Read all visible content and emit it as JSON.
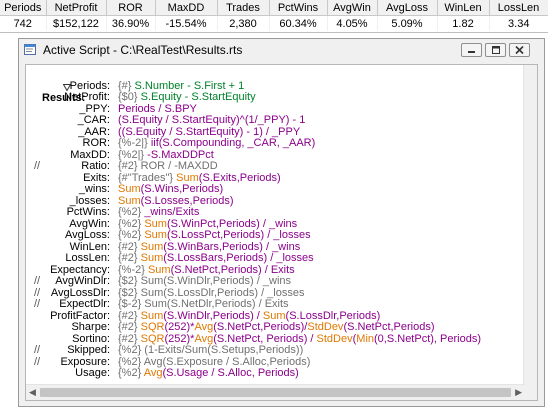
{
  "stats": {
    "headers": [
      "Periods",
      "NetProfit",
      "ROR",
      "MaxDD",
      "Trades",
      "PctWins",
      "AvgWin",
      "AvgLoss",
      "WinLen",
      "LossLen"
    ],
    "values": [
      "742",
      "$152,122",
      "36.90%",
      "-15.54%",
      "2,380",
      "60.34%",
      "4.05%",
      "5.09%",
      "1.82",
      "3.34"
    ]
  },
  "window": {
    "title": "Active Script - C:\\RealTest\\Results.rts",
    "section": "Results:"
  },
  "script": [
    {
      "label": "Periods:",
      "comment": "",
      "segs": [
        [
          "{#} ",
          "gray"
        ],
        [
          "S.Number - S.First + 1",
          "green"
        ]
      ]
    },
    {
      "label": "NetProfit:",
      "comment": "",
      "segs": [
        [
          "{$0} ",
          "gray"
        ],
        [
          "S.Equity - S.StartEquity",
          "green"
        ]
      ]
    },
    {
      "label": "_PPY:",
      "comment": "",
      "segs": [
        [
          "Periods / S.BPY",
          "purple"
        ]
      ]
    },
    {
      "label": "_CAR:",
      "comment": "",
      "segs": [
        [
          "(S.Equity / S.StartEquity)^(1/_PPY) - 1",
          "purple"
        ]
      ]
    },
    {
      "label": "_AAR:",
      "comment": "",
      "segs": [
        [
          "((S.Equity / S.StartEquity) - 1) / _PPY",
          "purple"
        ]
      ]
    },
    {
      "label": "ROR:",
      "comment": "",
      "segs": [
        [
          "{%-2|} ",
          "gray"
        ],
        [
          "iif(S.Compounding, _CAR, _AAR)",
          "purple"
        ]
      ]
    },
    {
      "label": "MaxDD:",
      "comment": "",
      "segs": [
        [
          "{%2|} ",
          "gray"
        ],
        [
          "-S.MaxDDPct",
          "purple"
        ]
      ]
    },
    {
      "label": "Ratio:",
      "comment": "//",
      "segs": [
        [
          "{#2} ROR / -MAXDD",
          "gray"
        ]
      ]
    },
    {
      "label": "Exits:",
      "comment": "",
      "segs": [
        [
          "{#\"Trades\"} ",
          "gray"
        ],
        [
          "Sum",
          "orange"
        ],
        [
          "(S.Exits,Periods)",
          "purple"
        ]
      ]
    },
    {
      "label": "_wins:",
      "comment": "",
      "segs": [
        [
          "Sum",
          "orange"
        ],
        [
          "(S.Wins,Periods)",
          "purple"
        ]
      ]
    },
    {
      "label": "_losses:",
      "comment": "",
      "segs": [
        [
          "Sum",
          "orange"
        ],
        [
          "(S.Losses,Periods)",
          "purple"
        ]
      ]
    },
    {
      "label": "PctWins:",
      "comment": "",
      "segs": [
        [
          "{%2} ",
          "gray"
        ],
        [
          "_wins/Exits",
          "purple"
        ]
      ]
    },
    {
      "label": "AvgWin:",
      "comment": "",
      "segs": [
        [
          "{%2} ",
          "gray"
        ],
        [
          "Sum",
          "orange"
        ],
        [
          "(S.WinPct,Periods) / _wins",
          "purple"
        ]
      ]
    },
    {
      "label": "AvgLoss:",
      "comment": "",
      "segs": [
        [
          "{%2} ",
          "gray"
        ],
        [
          "Sum",
          "orange"
        ],
        [
          "(S.LossPct,Periods) / _losses",
          "purple"
        ]
      ]
    },
    {
      "label": "WinLen:",
      "comment": "",
      "segs": [
        [
          "{#2} ",
          "gray"
        ],
        [
          "Sum",
          "orange"
        ],
        [
          "(S.WinBars,Periods) / _wins",
          "purple"
        ]
      ]
    },
    {
      "label": "LossLen:",
      "comment": "",
      "segs": [
        [
          "{#2} ",
          "gray"
        ],
        [
          "Sum",
          "orange"
        ],
        [
          "(S.LossBars,Periods) / _losses",
          "purple"
        ]
      ]
    },
    {
      "label": "Expectancy:",
      "comment": "",
      "segs": [
        [
          "{%-2} ",
          "gray"
        ],
        [
          "Sum",
          "orange"
        ],
        [
          "(S.NetPct,Periods) / Exits",
          "purple"
        ]
      ]
    },
    {
      "label": "AvgWinDlr:",
      "comment": "//",
      "segs": [
        [
          "{$2} Sum(S.WinDlr,Periods) / _wins",
          "gray"
        ]
      ]
    },
    {
      "label": "AvgLossDlr:",
      "comment": "//",
      "segs": [
        [
          "{$2} Sum(S.LossDlr,Periods) / _losses",
          "gray"
        ]
      ]
    },
    {
      "label": "ExpectDlr:",
      "comment": "//",
      "segs": [
        [
          "{$-2} Sum(S.NetDlr,Periods) / Exits",
          "gray"
        ]
      ]
    },
    {
      "label": "ProfitFactor:",
      "comment": "",
      "segs": [
        [
          "{#2} ",
          "gray"
        ],
        [
          "Sum",
          "orange"
        ],
        [
          "(S.WinDlr,Periods) / ",
          "purple"
        ],
        [
          "Sum",
          "orange"
        ],
        [
          "(S.LossDlr,Periods)",
          "purple"
        ]
      ]
    },
    {
      "label": "Sharpe:",
      "comment": "",
      "segs": [
        [
          "{#2} ",
          "gray"
        ],
        [
          "SQR",
          "orange"
        ],
        [
          "(252)*",
          "purple"
        ],
        [
          "Avg",
          "orange"
        ],
        [
          "(S.NetPct,Periods)/",
          "purple"
        ],
        [
          "StdDev",
          "orange"
        ],
        [
          "(S.NetPct,Periods)",
          "purple"
        ]
      ]
    },
    {
      "label": "Sortino:",
      "comment": "",
      "segs": [
        [
          "{#2} ",
          "gray"
        ],
        [
          "SQR",
          "orange"
        ],
        [
          "(252)*",
          "purple"
        ],
        [
          "Avg",
          "orange"
        ],
        [
          "(S.NetPct, Periods) / ",
          "purple"
        ],
        [
          "StdDev",
          "orange"
        ],
        [
          "(",
          "purple"
        ],
        [
          "Min",
          "orange"
        ],
        [
          "(0,S.NetPct), Periods)",
          "purple"
        ]
      ]
    },
    {
      "label": "Skipped:",
      "comment": "//",
      "segs": [
        [
          "{%2} (1-Exits/Sum(S.Setups,Periods))",
          "gray"
        ]
      ]
    },
    {
      "label": "Exposure:",
      "comment": "//",
      "segs": [
        [
          "{%2} Avg(S.Exposure / S.Alloc,Periods)",
          "gray"
        ]
      ]
    },
    {
      "label": "Usage:",
      "comment": "",
      "segs": [
        [
          "{%2} ",
          "gray"
        ],
        [
          "Avg",
          "orange"
        ],
        [
          "(S.Usage / S.Alloc, Periods)",
          "purple"
        ]
      ]
    }
  ],
  "icons": {
    "window_icon": "script-window-icon",
    "minimize": "minimize-icon",
    "maximize": "maximize-icon",
    "close": "close-icon",
    "fold": "collapse-toggle-icon"
  }
}
